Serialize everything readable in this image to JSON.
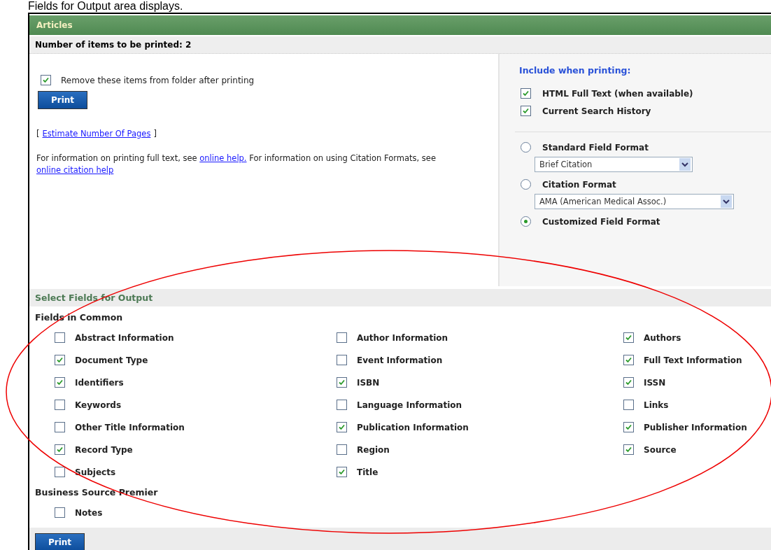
{
  "caption": "Fields for Output area displays.",
  "panel_title": "Articles",
  "count_label": "Number of items to be printed: 2",
  "remove_option": {
    "label": "Remove these items from folder after printing",
    "checked": true
  },
  "print_button": "Print",
  "estimate": {
    "open": "[",
    "link": "Estimate Number Of Pages",
    "close": "]"
  },
  "help_text": [
    {
      "kind": "text",
      "text": "For information on printing full text, see "
    },
    {
      "kind": "link",
      "text": "online help."
    },
    {
      "kind": "text",
      "text": " For information on using Citation Formats, see "
    },
    {
      "kind": "link",
      "text": "online citation help"
    }
  ],
  "include_heading": "Include when printing:",
  "include_options": [
    {
      "label": "HTML Full Text (when available)",
      "checked": true
    },
    {
      "label": "Current Search History",
      "checked": true
    }
  ],
  "formats": [
    {
      "label": "Standard Field Format",
      "selected": false,
      "dropdown": "Brief Citation"
    },
    {
      "label": "Citation Format",
      "selected": false,
      "dropdown": "AMA (American Medical Assoc.)"
    },
    {
      "label": "Customized Field Format",
      "selected": true
    }
  ],
  "fields_section_title": "Select Fields for Output",
  "field_groups": [
    {
      "title": "Fields in Common",
      "fields": [
        {
          "label": "Abstract Information",
          "checked": false
        },
        {
          "label": "Author Information",
          "checked": false
        },
        {
          "label": "Authors",
          "checked": true
        },
        {
          "label": "Document Type",
          "checked": true
        },
        {
          "label": "Event Information",
          "checked": false
        },
        {
          "label": "Full Text Information",
          "checked": true
        },
        {
          "label": "Identifiers",
          "checked": true
        },
        {
          "label": "ISBN",
          "checked": true
        },
        {
          "label": "ISSN",
          "checked": true
        },
        {
          "label": "Keywords",
          "checked": false
        },
        {
          "label": "Language Information",
          "checked": false
        },
        {
          "label": "Links",
          "checked": false
        },
        {
          "label": "Other Title Information",
          "checked": false
        },
        {
          "label": "Publication Information",
          "checked": true
        },
        {
          "label": "Publisher Information",
          "checked": true
        },
        {
          "label": "Record Type",
          "checked": true
        },
        {
          "label": "Region",
          "checked": false
        },
        {
          "label": "Source",
          "checked": true
        },
        {
          "label": "Subjects",
          "checked": false
        },
        {
          "label": "Title",
          "checked": true
        }
      ]
    },
    {
      "title": "Business Source Premier",
      "fields": [
        {
          "label": "Notes",
          "checked": false
        }
      ]
    }
  ],
  "bottom_print_button": "Print"
}
